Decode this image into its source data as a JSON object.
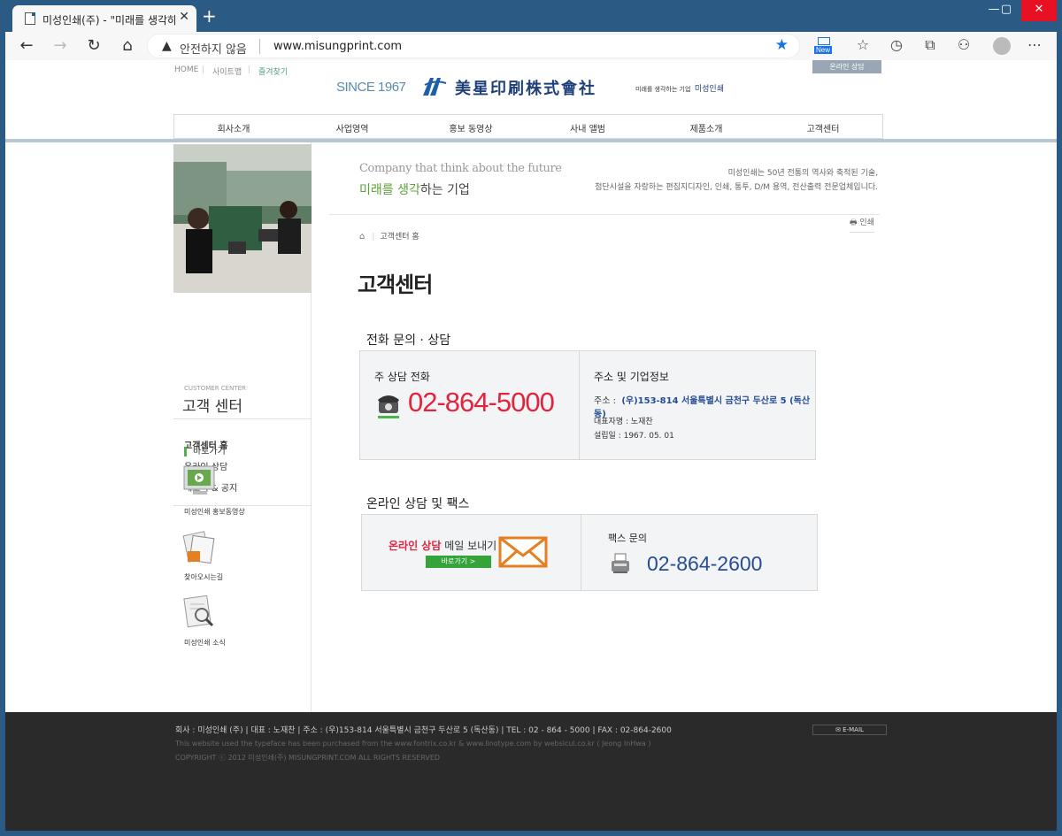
{
  "browser": {
    "tab_title": "미성인쇄(주) - \"미래를 생각하는",
    "tab_close": "✕",
    "new_tab": "+",
    "insecure_label": "안전하지 않음",
    "url": "www.misungprint.com",
    "new_badge": "New",
    "controls": {
      "min": "—",
      "max": "▢",
      "close": "✕"
    }
  },
  "header": {
    "util_links": [
      "HOME",
      "사이트맵",
      "즐겨찾기"
    ],
    "online_tab": "온라인 상담",
    "since": "SINCE 1967",
    "logo_hanja": "美星印刷株式會社",
    "tagline_small": "미래를 생각하는 기업",
    "tagline_brand": "미성인쇄"
  },
  "gnb": [
    "회사소개",
    "사업영역",
    "홍보 동영상",
    "사내 앨범",
    "제품소개",
    "고객센터"
  ],
  "sidebar": {
    "title_en": "CUSTOMER CENTER",
    "title_ko": "고객 센터",
    "menu": [
      "고객센터 홈",
      "온라인 상담",
      "새소식 & 공지"
    ],
    "quick_title": "바로가기",
    "quick_links": [
      "미성인쇄 홍보동영상",
      "찾아오시는길",
      "미성인쇄 소식"
    ]
  },
  "banner": {
    "en": "Company that think about the future",
    "ko_highlight": "미래를 생각",
    "ko_rest": "하는 기업",
    "desc_line1": "미성인쇄는 50년 전통의 역사와 축적된 기술,",
    "desc_line2": "첨단시설을 자랑하는 편집지디자인, 인쇄, 통투, D/M 용역, 전산출력 전문업체입니다."
  },
  "content": {
    "print_label": "인쇄",
    "breadcrumb_home": "⌂",
    "breadcrumb": "고객센터 홈",
    "page_title": "고객센터",
    "section1_title": "전화 문의 · 상담",
    "phone_label": "주 상담 전화",
    "phone_number": "02-864-5000",
    "info_label": "주소 및 기업정보",
    "addr_prefix": "주소 :",
    "addr_value": "(우)153-814 서울특별시 금천구 두산로 5 (독산동)",
    "rep": "대표자명 : 노재찬",
    "established": "설립일 : 1967. 05. 01",
    "section2_title": "온라인 상담 및 팩스",
    "online_red": "온라인 상담",
    "online_rest": " 메일 보내기",
    "go_button": "바로가기 >",
    "fax_label": "팩스 문의",
    "fax_number": "02-864-2600"
  },
  "footer": {
    "line1": "회사 : 미성인쇄 (주)   |   대표 : 노재찬   |   주소 :  (우)153-814  서울특별시 금천구 두산로 5 (독산동)   |   TEL : 02 - 864 - 5000   |   FAX :  02-864-2600",
    "line2": "This website used the typeface has been purchased from the www.fontrix.co.kr & www.linotype.com  by  websicul.co.kr ( Jeong InHwa )",
    "line3": "COPYRIGHT ⓒ 2012  미성인쇄(주)  MISUNGPRINT.COM  ALL RIGHTS RESERVED",
    "email_btn": "✉ E-MAIL"
  },
  "colors": {
    "browser_frame": "#2b5a85",
    "phone_red": "#e2253f",
    "fax_blue": "#264c96",
    "accent_green": "#5ba238",
    "footer_bg": "#2a2a2a"
  }
}
